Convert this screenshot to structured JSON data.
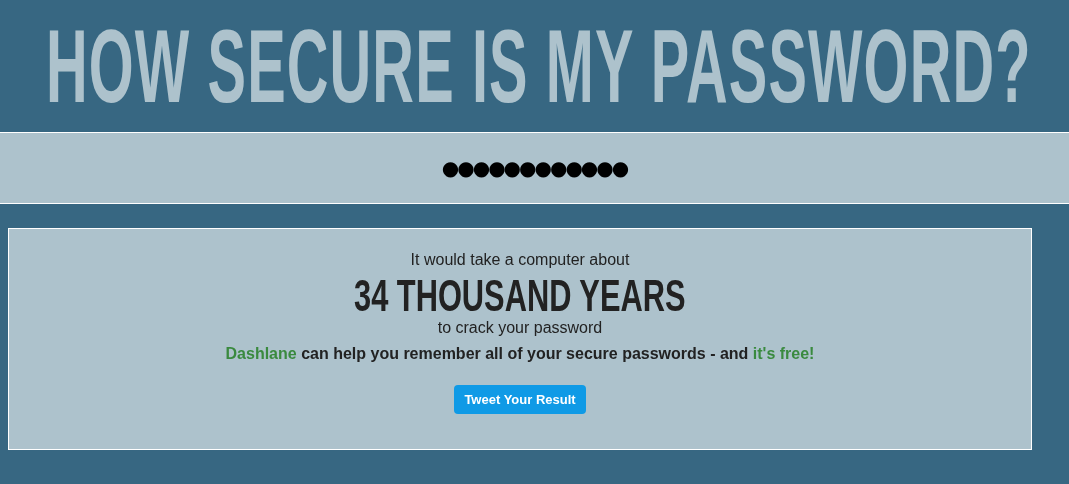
{
  "title": "HOW SECURE IS MY PASSWORD?",
  "password_field": {
    "value": "●●●●●●●●●●●●"
  },
  "result": {
    "intro": "It would take a computer about",
    "time": "34 THOUSAND YEARS",
    "outro": "to crack your password",
    "promo": {
      "brand_link": "Dashlane",
      "text": "can help you remember all of your secure passwords - and",
      "free_link": "it's free!"
    },
    "button": "Tweet Your Result"
  }
}
